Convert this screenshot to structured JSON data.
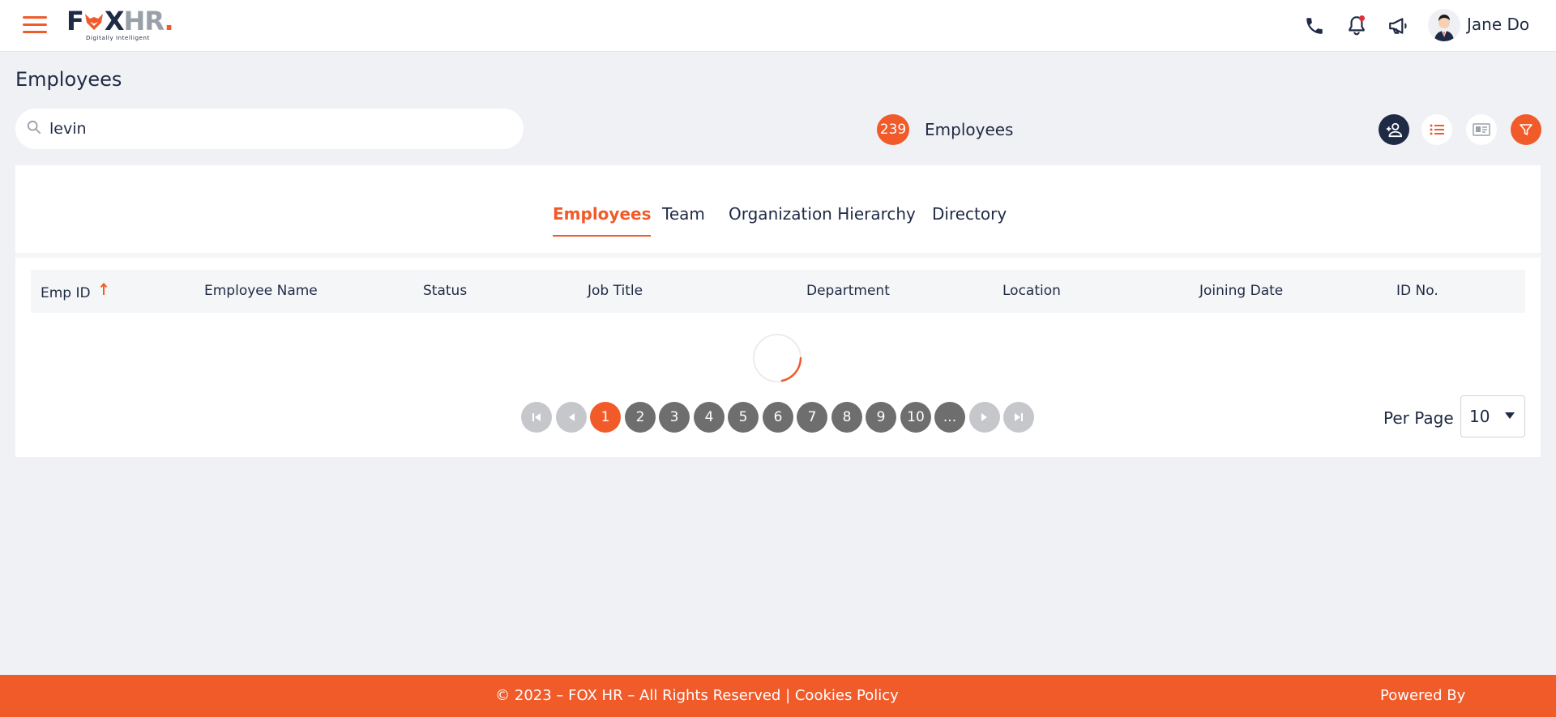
{
  "app": {
    "logo_text_fx": "F",
    "logo_text_o": "O",
    "logo_text_x": "X",
    "logo_text_hr": "HR",
    "logo_dot": ".",
    "logo_tagline": "Digitally Intelligent",
    "brand_color": "#f15a29",
    "navy_color": "#1f2a44"
  },
  "header": {
    "user_name": "Jane Do",
    "icons": [
      "phone-icon",
      "bell-icon",
      "megaphone-icon"
    ],
    "notification_dot": true
  },
  "page": {
    "title": "Employees"
  },
  "search": {
    "value": "levin",
    "placeholder": ""
  },
  "summary": {
    "count": "239",
    "label": "Employees"
  },
  "toolbar": {
    "buttons": [
      "add-employee-button",
      "list-view-button",
      "card-view-button",
      "filter-button"
    ]
  },
  "tabs": [
    {
      "label": "Employees",
      "active": true
    },
    {
      "label": "Team",
      "active": false
    },
    {
      "label": "Organization Hierarchy",
      "active": false
    },
    {
      "label": "Directory",
      "active": false
    }
  ],
  "table": {
    "columns": [
      "Emp ID",
      "Employee Name",
      "Status",
      "Job Title",
      "Department",
      "Location",
      "Joining Date",
      "ID No."
    ],
    "sort_column": "Emp ID",
    "sort_direction": "ascending",
    "loading": true
  },
  "pagination": {
    "pages": [
      "1",
      "2",
      "3",
      "4",
      "5",
      "6",
      "7",
      "8",
      "9",
      "10"
    ],
    "ellipsis": "...",
    "current": "1",
    "per_page_label": "Per Page",
    "per_page_value": "10"
  },
  "footer": {
    "copyright": "© 2023 – FOX HR – All Rights Reserved | ",
    "cookies_link": "Cookies Policy",
    "powered_by": "Powered By"
  }
}
